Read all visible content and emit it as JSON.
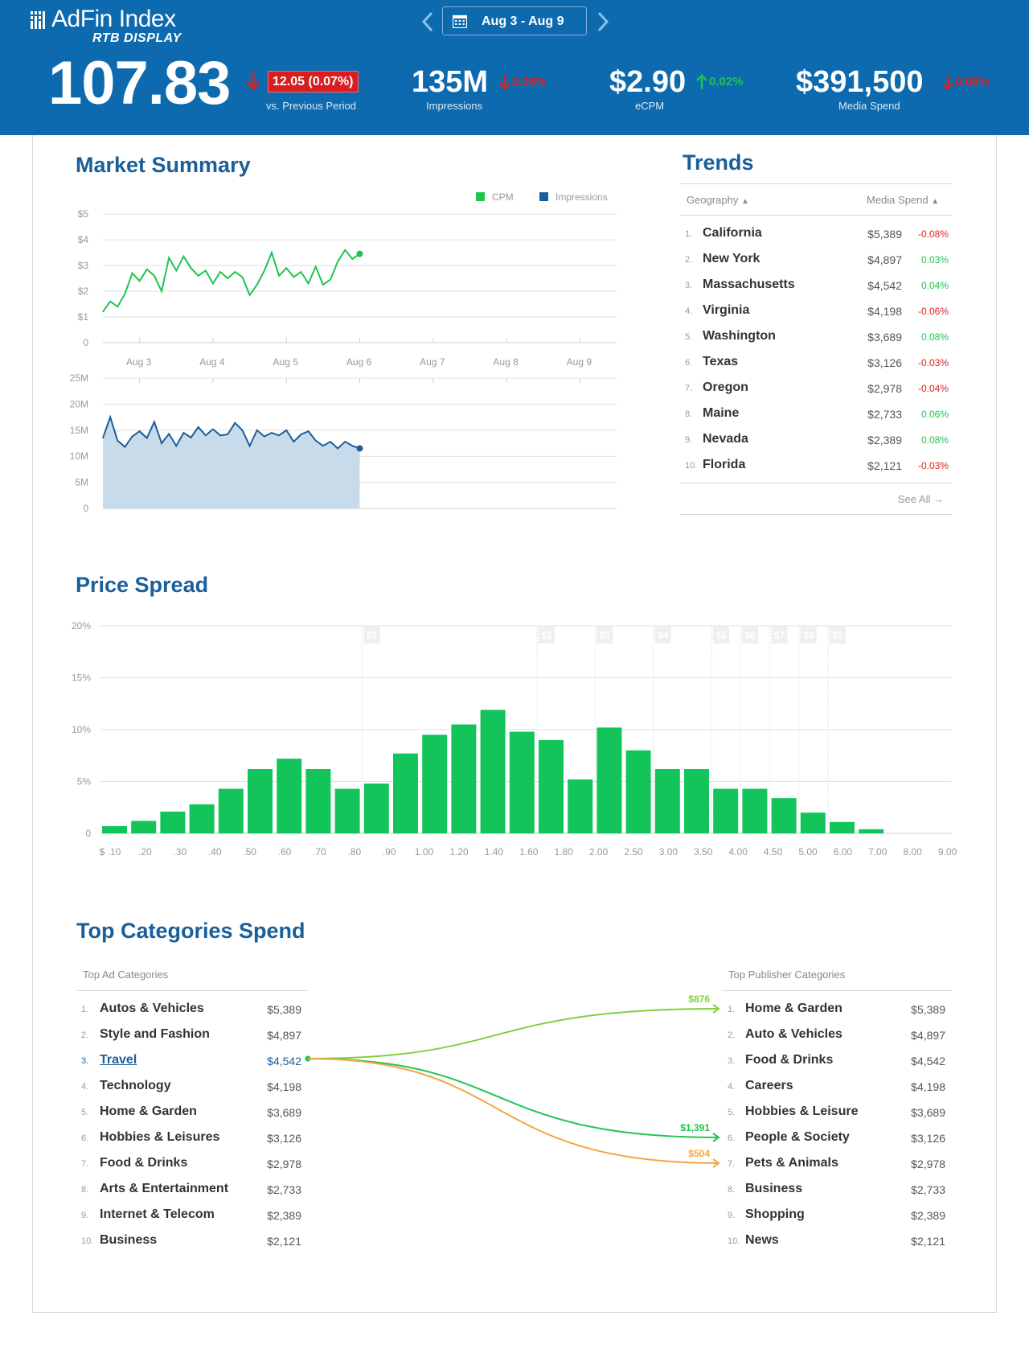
{
  "header": {
    "brand_name": "AdFin Index",
    "brand_sub": "RTB DISPLAY",
    "date_range": "Aug 3 - Aug 9",
    "index_value": "107.83",
    "index_change": "12.05 (0.07%)",
    "index_sub": "vs. Previous Period",
    "kpis": [
      {
        "value": "135M",
        "change": "0.08%",
        "direction": "down",
        "label": "Impressions"
      },
      {
        "value": "$2.90",
        "change": "0.02%",
        "direction": "up",
        "label": "eCPM"
      },
      {
        "value": "$391,500",
        "change": "0.08%",
        "direction": "down",
        "label": "Media Spend"
      }
    ],
    "colors": {
      "bg": "#0d6aae",
      "up": "#1fc44f",
      "down": "#e0201b"
    }
  },
  "market_summary": {
    "title": "Market Summary",
    "legend": [
      {
        "name": "CPM",
        "color": "#1fc44f"
      },
      {
        "name": "Impressions",
        "color": "#1a5e9a"
      }
    ],
    "chart_data": [
      {
        "type": "line",
        "name": "CPM",
        "color": "#1fc44f",
        "y_ticks": [
          "$5",
          "$4",
          "$3",
          "$2",
          "$1",
          "0"
        ],
        "ylim": [
          0,
          5
        ],
        "x_ticks": [
          "Aug 3",
          "Aug 4",
          "Aug 5",
          "Aug 6",
          "Aug 7",
          "Aug 8",
          "Aug 9"
        ],
        "xlim": [
          0,
          7
        ],
        "x": [
          0,
          0.1,
          0.2,
          0.3,
          0.4,
          0.5,
          0.6,
          0.7,
          0.8,
          0.9,
          1.0,
          1.1,
          1.2,
          1.3,
          1.4,
          1.5,
          1.6,
          1.7,
          1.8,
          1.9,
          2.0,
          2.1,
          2.2,
          2.3,
          2.4,
          2.5,
          2.6,
          2.7,
          2.8,
          2.9,
          3.0,
          3.1,
          3.2,
          3.3,
          3.4,
          3.5
        ],
        "values": [
          1.2,
          1.6,
          1.4,
          1.9,
          2.7,
          2.4,
          2.85,
          2.6,
          2.0,
          3.3,
          2.8,
          3.35,
          2.9,
          2.6,
          2.8,
          2.3,
          2.75,
          2.5,
          2.75,
          2.55,
          1.85,
          2.25,
          2.8,
          3.5,
          2.6,
          2.9,
          2.55,
          2.75,
          2.3,
          2.95,
          2.25,
          2.45,
          3.15,
          3.6,
          3.25,
          3.45
        ]
      },
      {
        "type": "area",
        "name": "Impressions",
        "color": "#1a5e9a",
        "y_ticks": [
          "25M",
          "20M",
          "15M",
          "10M",
          "5M",
          "0"
        ],
        "ylim": [
          0,
          25
        ],
        "xlim": [
          0,
          7
        ],
        "x": [
          0,
          0.1,
          0.2,
          0.3,
          0.4,
          0.5,
          0.6,
          0.7,
          0.8,
          0.9,
          1.0,
          1.1,
          1.2,
          1.3,
          1.4,
          1.5,
          1.6,
          1.7,
          1.8,
          1.9,
          2.0,
          2.1,
          2.2,
          2.3,
          2.4,
          2.5,
          2.6,
          2.7,
          2.8,
          2.9,
          3.0,
          3.1,
          3.2,
          3.3,
          3.4,
          3.5
        ],
        "values": [
          13.5,
          17.5,
          13.0,
          11.8,
          13.8,
          14.8,
          13.5,
          16.6,
          12.5,
          14.3,
          12.0,
          14.5,
          13.6,
          15.6,
          14.0,
          15.2,
          14.0,
          14.2,
          16.4,
          15.0,
          12.0,
          15.0,
          13.8,
          14.5,
          14.0,
          15.0,
          12.8,
          14.2,
          14.8,
          13.0,
          12.0,
          12.8,
          11.5,
          12.8,
          12.0,
          11.5
        ]
      }
    ]
  },
  "trends": {
    "title": "Trends",
    "col_geo": "Geography",
    "col_spend": "Media Spend",
    "see_all": "See All",
    "rows": [
      {
        "rank": "1.",
        "name": "California",
        "spend": "$5,389",
        "change": "-0.08%",
        "dir": "neg"
      },
      {
        "rank": "2.",
        "name": "New York",
        "spend": "$4,897",
        "change": "0.03%",
        "dir": "pos"
      },
      {
        "rank": "3.",
        "name": "Massachusetts",
        "spend": "$4,542",
        "change": "0.04%",
        "dir": "pos"
      },
      {
        "rank": "4.",
        "name": "Virginia",
        "spend": "$4,198",
        "change": "-0.06%",
        "dir": "neg"
      },
      {
        "rank": "5.",
        "name": "Washington",
        "spend": "$3,689",
        "change": "0.08%",
        "dir": "pos"
      },
      {
        "rank": "6.",
        "name": "Texas",
        "spend": "$3,126",
        "change": "-0.03%",
        "dir": "neg"
      },
      {
        "rank": "7.",
        "name": "Oregon",
        "spend": "$2,978",
        "change": "-0.04%",
        "dir": "neg"
      },
      {
        "rank": "8.",
        "name": "Maine",
        "spend": "$2,733",
        "change": "0.06%",
        "dir": "pos"
      },
      {
        "rank": "9.",
        "name": "Nevada",
        "spend": "$2,389",
        "change": "0.08%",
        "dir": "pos"
      },
      {
        "rank": "10.",
        "name": "Florida",
        "spend": "$2,121",
        "change": "-0.03%",
        "dir": "neg"
      }
    ]
  },
  "price_spread": {
    "title": "Price Spread",
    "chart_data": {
      "type": "bar",
      "color": "#13c45a",
      "y_ticks": [
        "20%",
        "15%",
        "10%",
        "5%",
        "0"
      ],
      "ylim": [
        0,
        20
      ],
      "categories": [
        "$ .10",
        ".20",
        ".30",
        ".40",
        ".50",
        ".60",
        ".70",
        ".80",
        ".90",
        "1.00",
        "1.20",
        "1.40",
        "1.60",
        "1.80",
        "2.00",
        "2.50",
        "3.00",
        "3.50",
        "4.00",
        "4.50",
        "5.00",
        "6.00",
        "7.00",
        "8.00",
        "9.00"
      ],
      "values": [
        0.7,
        1.2,
        2.1,
        2.8,
        4.3,
        6.2,
        7.2,
        6.2,
        4.3,
        4.8,
        7.7,
        9.5,
        10.5,
        11.9,
        9.8,
        9.0,
        5.2,
        10.2,
        8.0,
        6.2,
        6.2,
        4.3,
        4.3,
        3.4,
        2.0,
        1.1,
        0.4
      ],
      "price_markers": [
        {
          "label": "$1",
          "after": 8
        },
        {
          "label": "$2",
          "after": 14
        },
        {
          "label": "$3",
          "after": 16
        },
        {
          "label": "$4",
          "after": 18
        },
        {
          "label": "$5",
          "after": 20
        },
        {
          "label": "$6",
          "after": 21
        },
        {
          "label": "$7",
          "after": 22
        },
        {
          "label": "$8",
          "after": 23
        },
        {
          "label": "$9",
          "after": 24
        }
      ]
    }
  },
  "categories": {
    "title": "Top Categories Spend",
    "ad_head": "Top Ad Categories",
    "pub_head": "Top Publisher Categories",
    "ad_rows": [
      {
        "rank": "1.",
        "name": "Autos & Vehicles",
        "spend": "$5,389"
      },
      {
        "rank": "2.",
        "name": "Style and Fashion",
        "spend": "$4,897"
      },
      {
        "rank": "3.",
        "name": "Travel",
        "spend": "$4,542"
      },
      {
        "rank": "4.",
        "name": "Technology",
        "spend": "$4,198"
      },
      {
        "rank": "5.",
        "name": "Home & Garden",
        "spend": "$3,689"
      },
      {
        "rank": "6.",
        "name": "Hobbies & Leisures",
        "spend": "$3,126"
      },
      {
        "rank": "7.",
        "name": "Food & Drinks",
        "spend": "$2,978"
      },
      {
        "rank": "8.",
        "name": "Arts & Entertainment",
        "spend": "$2,733"
      },
      {
        "rank": "9.",
        "name": "Internet & Telecom",
        "spend": "$2,389"
      },
      {
        "rank": "10.",
        "name": "Business",
        "spend": "$2,121"
      }
    ],
    "pub_rows": [
      {
        "rank": "1.",
        "name": "Home & Garden",
        "spend": "$5,389"
      },
      {
        "rank": "2.",
        "name": "Auto & Vehicles",
        "spend": "$4,897"
      },
      {
        "rank": "3.",
        "name": "Food & Drinks",
        "spend": "$4,542"
      },
      {
        "rank": "4.",
        "name": "Careers",
        "spend": "$4,198"
      },
      {
        "rank": "5.",
        "name": "Hobbies & Leisure",
        "spend": "$3,689"
      },
      {
        "rank": "6.",
        "name": "People & Society",
        "spend": "$3,126"
      },
      {
        "rank": "7.",
        "name": "Pets & Animals",
        "spend": "$2,978"
      },
      {
        "rank": "8.",
        "name": "Business",
        "spend": "$2,733"
      },
      {
        "rank": "9.",
        "name": "Shopping",
        "spend": "$2,389"
      },
      {
        "rank": "10.",
        "name": "News",
        "spend": "$2,121"
      }
    ],
    "flows": [
      {
        "value": "$876",
        "to_rank": 1,
        "color": "#7fd13f"
      },
      {
        "value": "$1,391",
        "to_rank": 6,
        "color": "#1fc44f"
      },
      {
        "value": "$504",
        "to_rank": 7,
        "color": "#f5a540"
      }
    ]
  }
}
